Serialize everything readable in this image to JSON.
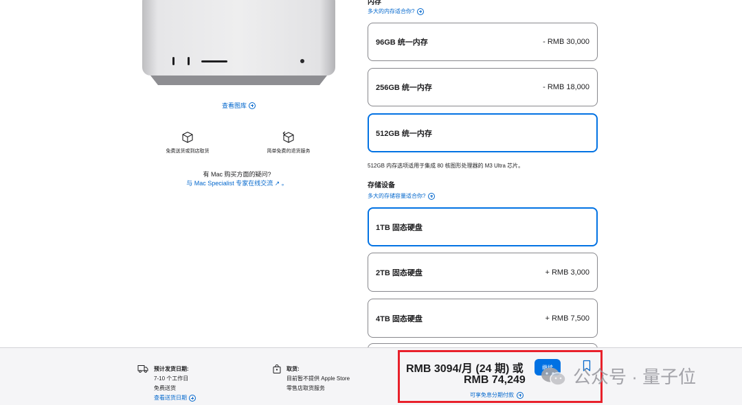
{
  "left": {
    "gallery_link": "查看图库",
    "features": [
      {
        "label": "免费送货或到店取货",
        "icon": "box-icon"
      },
      {
        "label": "简单免费的退货服务",
        "icon": "return-box-icon"
      }
    ],
    "question_line1": "有 Mac 购买方面的疑问?",
    "question_line2": "与 Mac Specialist 专家在线交流 ↗ 。"
  },
  "memory": {
    "header_partial": "内存",
    "help_link": "多大的内存适合你?",
    "options": [
      {
        "name": "96GB 统一内存",
        "price": "- RMB 30,000",
        "selected": false
      },
      {
        "name": "256GB 统一内存",
        "price": "- RMB 18,000",
        "selected": false
      },
      {
        "name": "512GB 统一内存",
        "price": "",
        "selected": true
      }
    ],
    "note": "512GB 内存选项适用于集成 80 核图形处理器的 M3 Ultra 芯片。"
  },
  "storage": {
    "header": "存储设备",
    "help_link": "多大的存储容量适合你?",
    "options": [
      {
        "name": "1TB 固态硬盘",
        "price": "",
        "selected": true
      },
      {
        "name": "2TB 固态硬盘",
        "price": "+ RMB 3,000",
        "selected": false
      },
      {
        "name": "4TB 固态硬盘",
        "price": "+ RMB 7,500",
        "selected": false
      }
    ]
  },
  "bottom": {
    "ship_title": "预计发货日期:",
    "ship_days": "7-10 个工作日",
    "ship_free": "免费送货",
    "ship_link": "查看送货日期",
    "pickup_title": "取货:",
    "pickup_line1": "目前暂不提供 Apple Store",
    "pickup_line2": "零售店取货服务",
    "price_line1": "RMB 3094/月 (24 期) 或",
    "price_line2": "RMB 74,249",
    "installment_link": "可享免息分期付款",
    "continue_label": "继续"
  },
  "watermark": "公众号 · 量子位",
  "colors": {
    "accent": "#0071e3",
    "link": "#0066cc",
    "highlight": "#e8202a"
  }
}
